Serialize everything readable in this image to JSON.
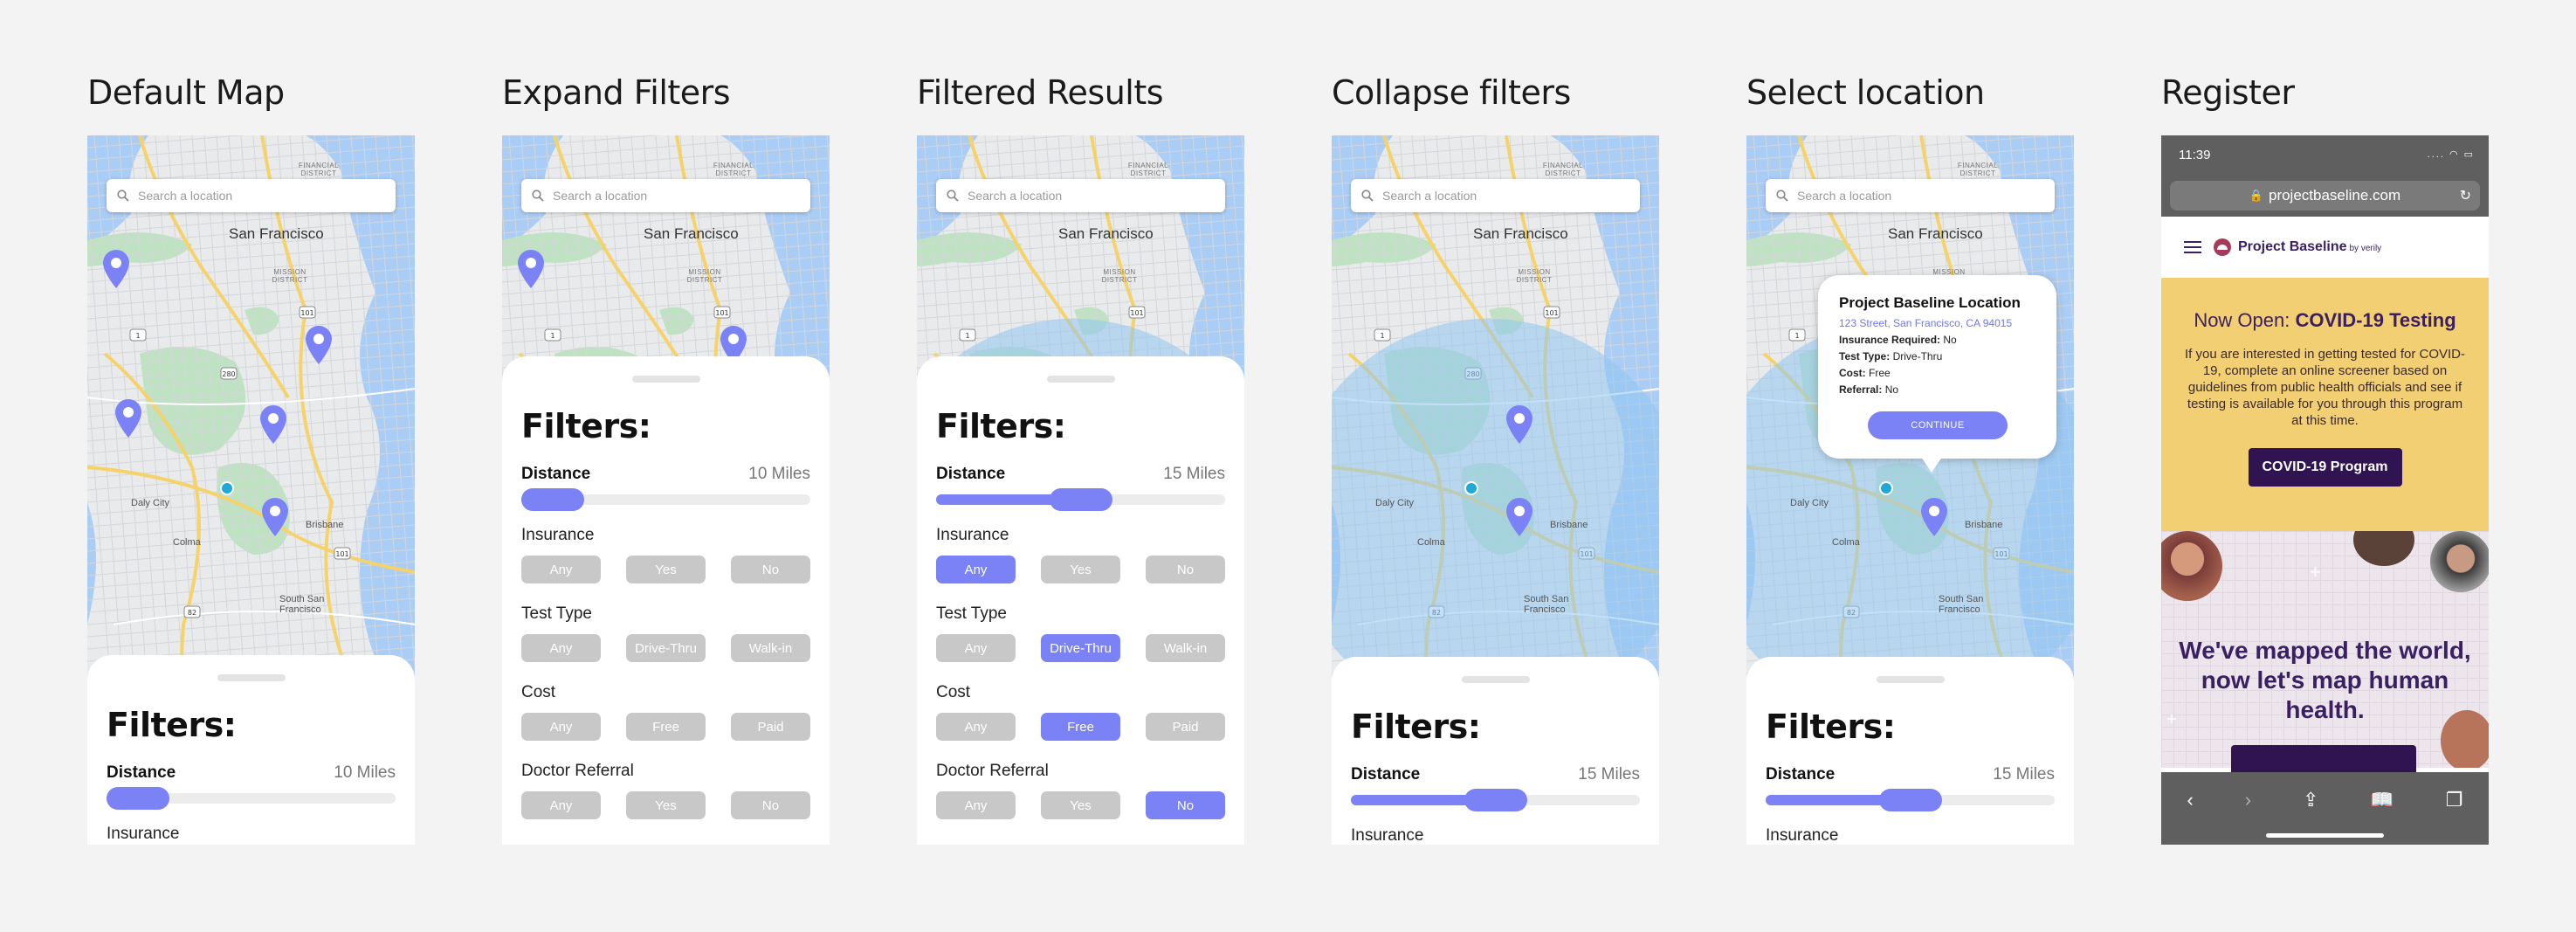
{
  "frames": [
    {
      "title": "Default Map",
      "variant": "default"
    },
    {
      "title": "Expand Filters",
      "variant": "expand"
    },
    {
      "title": "Filtered Results",
      "variant": "filtered"
    },
    {
      "title": "Collapse filters",
      "variant": "collapse"
    },
    {
      "title": "Select location",
      "variant": "select"
    },
    {
      "title": "Register",
      "variant": "register"
    }
  ],
  "map": {
    "search_placeholder": "Search a location",
    "labels": {
      "city": "San Francisco",
      "financial": "FINANCIAL DISTRICT",
      "mission": "MISSION DISTRICT",
      "daly": "Daly City",
      "colma": "Colma",
      "brisbane": "Brisbane",
      "ssf": "South San Francisco"
    },
    "route_shields": [
      "101",
      "1",
      "280",
      "101",
      "82",
      "101",
      "280"
    ],
    "water_color": "#aacdf5",
    "park_color": "#bfe2c3",
    "radius_color": "#8fc7f0"
  },
  "filters": {
    "title": "Filters:",
    "distance_label": "Distance",
    "distance_values": [
      "10 Miles",
      "15 Miles"
    ],
    "slider_positions": [
      0.1,
      0.5
    ],
    "insurance_label": "Insurance",
    "insurance_options": [
      "Any",
      "Yes",
      "No"
    ],
    "test_type_label": "Test Type",
    "test_type_options": [
      "Any",
      "Drive-Thru",
      "Walk-in"
    ],
    "cost_label": "Cost",
    "cost_options": [
      "Any",
      "Free",
      "Paid"
    ],
    "referral_label": "Doctor Referral",
    "referral_options": [
      "Any",
      "Yes",
      "No"
    ],
    "cut_label": "Insurance"
  },
  "popup": {
    "title": "Project Baseline Location",
    "address": "123 Street, San Francisco, CA 94015",
    "insurance_key": "Insurance Required:",
    "insurance_val": "No",
    "test_type_key": "Test Type:",
    "test_type_val": "Drive-Thru",
    "cost_key": "Cost:",
    "cost_val": "Free",
    "referral_key": "Referral:",
    "referral_val": "No",
    "cta": "CONTINUE"
  },
  "register": {
    "time": "11:39",
    "url": "projectbaseline.com",
    "brand": "Project Baseline",
    "brand_suffix": "by verily",
    "hero_prefix": "Now Open:",
    "hero_bold": "COVID-19 Testing",
    "hero_text": "If you are interested in getting tested for COVID-19, complete an online screener based on guidelines from public health officials and see if testing is available for you through this program at this time.",
    "hero_button": "COVID-19 Program",
    "headline": "We've mapped the world, now let's map human health."
  },
  "colors": {
    "accent": "#7b82f5",
    "inactive": "#c8c8c8",
    "brand_purple": "#3a1f63",
    "hero_yellow": "#f2cf72"
  }
}
